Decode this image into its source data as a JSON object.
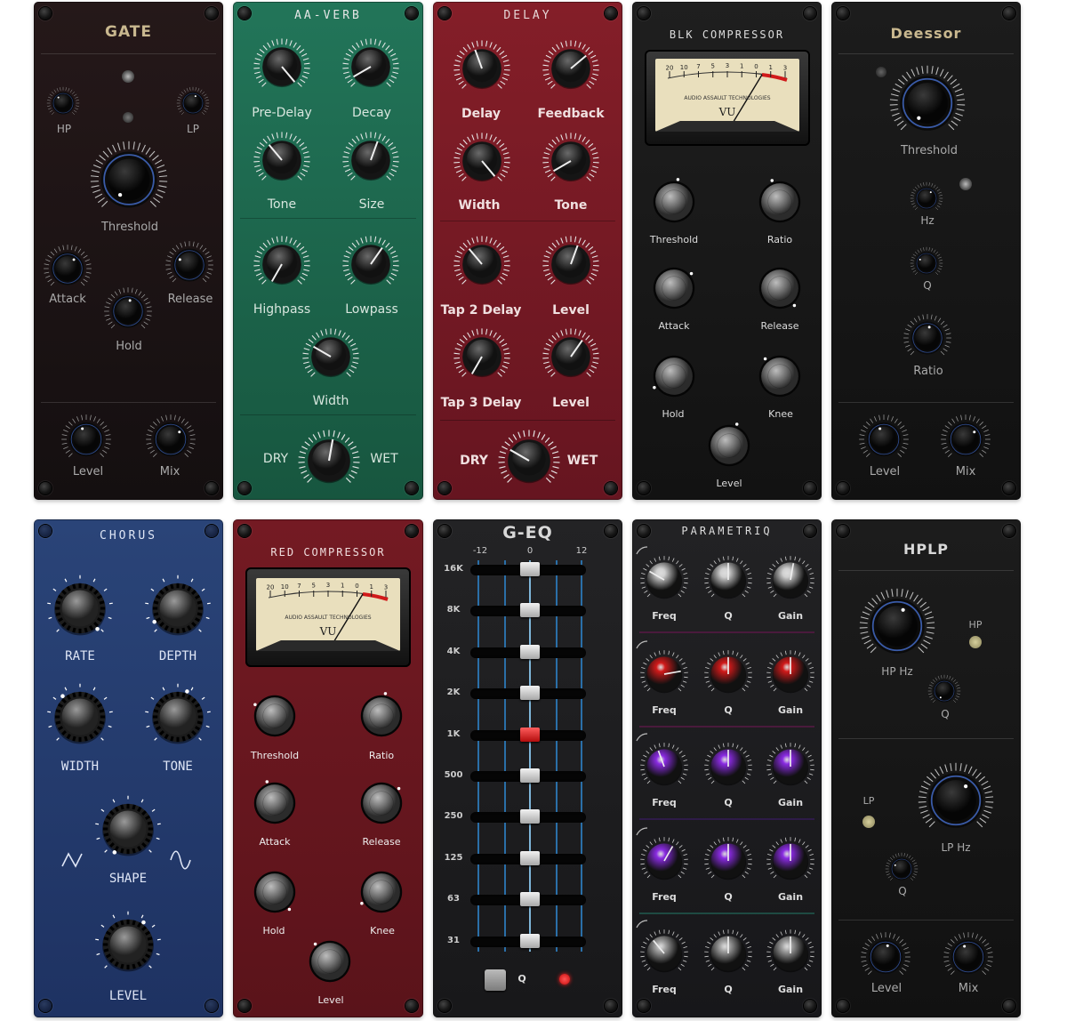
{
  "gate": {
    "title": "GATE",
    "hp": "HP",
    "lp": "LP",
    "threshold": "Threshold",
    "attack": "Attack",
    "release": "Release",
    "hold": "Hold",
    "level": "Level",
    "mix": "Mix"
  },
  "verb": {
    "title": "AA-VERB",
    "predelay": "Pre-Delay",
    "decay": "Decay",
    "tone": "Tone",
    "size": "Size",
    "highpass": "Highpass",
    "lowpass": "Lowpass",
    "width": "Width",
    "dry": "DRY",
    "wet": "WET"
  },
  "delay": {
    "title": "DELAY",
    "delay": "Delay",
    "feedback": "Feedback",
    "width": "Width",
    "tone": "Tone",
    "tap2": "Tap 2 Delay",
    "level2": "Level",
    "tap3": "Tap 3 Delay",
    "level3": "Level",
    "dry": "DRY",
    "wet": "WET"
  },
  "blk": {
    "title": "BLK COMPRESSOR",
    "vu_brand": "AUDIO ASSAULT TECHNOLOGIES",
    "vu": "VU",
    "scale": [
      "20",
      "10",
      "7",
      "5",
      "3",
      "1",
      "0",
      "1",
      "3"
    ],
    "threshold": "Threshold",
    "ratio": "Ratio",
    "attack": "Attack",
    "release": "Release",
    "hold": "Hold",
    "knee": "Knee",
    "level": "Level"
  },
  "deessor": {
    "title": "Deessor",
    "threshold": "Threshold",
    "hz": "Hz",
    "q": "Q",
    "ratio": "Ratio",
    "level": "Level",
    "mix": "Mix"
  },
  "chorus": {
    "title": "CHORUS",
    "rate": "RATE",
    "depth": "DEPTH",
    "width": "WIDTH",
    "tone": "TONE",
    "shape": "SHAPE",
    "level": "LEVEL"
  },
  "red": {
    "title": "RED COMPRESSOR",
    "vu_brand": "AUDIO ASSAULT TECHNOLOGIES",
    "vu": "VU",
    "scale": [
      "20",
      "10",
      "7",
      "5",
      "3",
      "1",
      "0",
      "1",
      "3"
    ],
    "threshold": "Threshold",
    "ratio": "Ratio",
    "attack": "Attack",
    "release": "Release",
    "hold": "Hold",
    "knee": "Knee",
    "level": "Level"
  },
  "geq": {
    "title": "G-EQ",
    "scale": [
      "-12",
      "0",
      "12"
    ],
    "bands": [
      "16K",
      "8K",
      "4K",
      "2K",
      "1K",
      "500",
      "250",
      "125",
      "63",
      "31"
    ],
    "q": "Q"
  },
  "para": {
    "title": "PARAMETRIQ",
    "freq": "Freq",
    "q": "Q",
    "gain": "Gain"
  },
  "hplp": {
    "title": "HPLP",
    "hphz": "HP Hz",
    "hp": "HP",
    "q1": "Q",
    "lp": "LP",
    "lphz": "LP Hz",
    "q2": "Q",
    "level": "Level",
    "mix": "Mix"
  },
  "colors": {
    "gate": "#1e1416",
    "verb": "#1f6b55",
    "delay": "#7a1a24",
    "blk": "#1a1a1a",
    "deessor": "#171717",
    "chorus": "#24396b",
    "red": "#6b1820",
    "geq": "#1d1d1f",
    "para": "#1d1d1f",
    "hplp": "#171717",
    "accent_red": "#d11a1a",
    "accent_purple": "#8a2be2"
  }
}
